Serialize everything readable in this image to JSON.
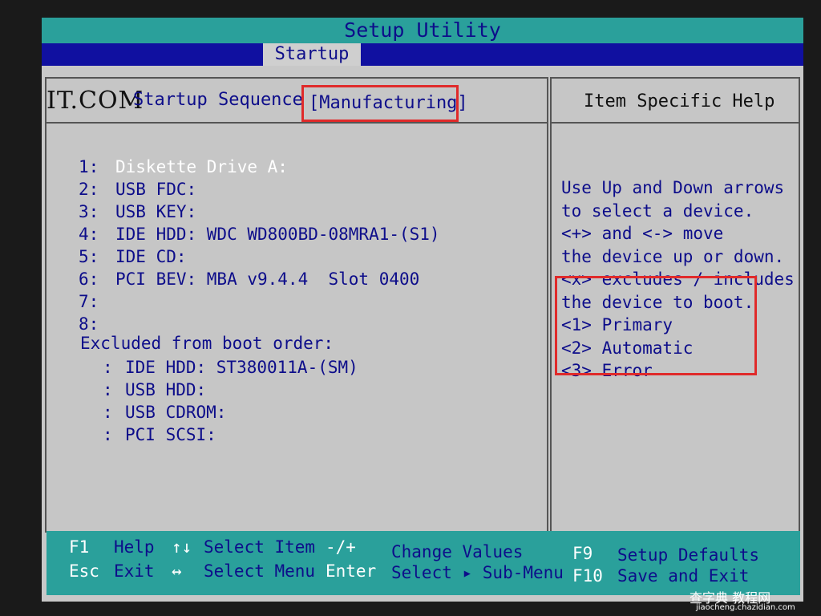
{
  "window": {
    "title": "Setup Utility"
  },
  "menu": {
    "active_tab": "Startup"
  },
  "watermark": {
    "left": "IT.COM",
    "bottom_right_main": "查字典 教程网",
    "bottom_right_sub": "jiaocheng.chazidian.com"
  },
  "startup": {
    "sequence_label": "Startup Sequence",
    "sequence_value": "[Manufacturing]",
    "boot_order": [
      {
        "num": "1:",
        "device": "Diskette Drive A:"
      },
      {
        "num": "2:",
        "device": "USB FDC:"
      },
      {
        "num": "3:",
        "device": "USB KEY:"
      },
      {
        "num": "4:",
        "device": "IDE HDD: WDC WD800BD-08MRA1-(S1)"
      },
      {
        "num": "5:",
        "device": "IDE CD:"
      },
      {
        "num": "6:",
        "device": "PCI BEV: MBA v9.4.4  Slot 0400"
      },
      {
        "num": "7:",
        "device": ""
      },
      {
        "num": "8:",
        "device": ""
      }
    ],
    "excluded_title": "Excluded from boot order:",
    "excluded": [
      {
        "num": ":",
        "device": "IDE HDD: ST380011A-(SM)"
      },
      {
        "num": ":",
        "device": "USB HDD:"
      },
      {
        "num": ":",
        "device": "USB CDROM:"
      },
      {
        "num": ":",
        "device": "PCI SCSI:"
      }
    ]
  },
  "help": {
    "title": "Item Specific Help",
    "lines": [
      "Use Up and Down arrows",
      "to select a device.",
      "<+> and <-> move",
      "the device up or down.",
      "<x> excludes / includes",
      "the device to boot.",
      "<1> Primary",
      "<2> Automatic",
      "<3> Error"
    ]
  },
  "footer": {
    "f1_key": "F1",
    "f1_label": "Help",
    "esc_key": "Esc",
    "esc_label": "Exit",
    "arrows_ud_key": "↑↓",
    "arrows_ud_label": "Select Item",
    "arrows_lr_key": "↔",
    "arrows_lr_label": "Select Menu",
    "plusminus_key": "-/+",
    "plusminus_label": "Change Values",
    "enter_key": "Enter",
    "enter_label": "Select ▸ Sub-Menu",
    "f9_key": "F9",
    "f9_label": "Setup Defaults",
    "f10_key": "F10",
    "f10_label": "Save and Exit"
  }
}
